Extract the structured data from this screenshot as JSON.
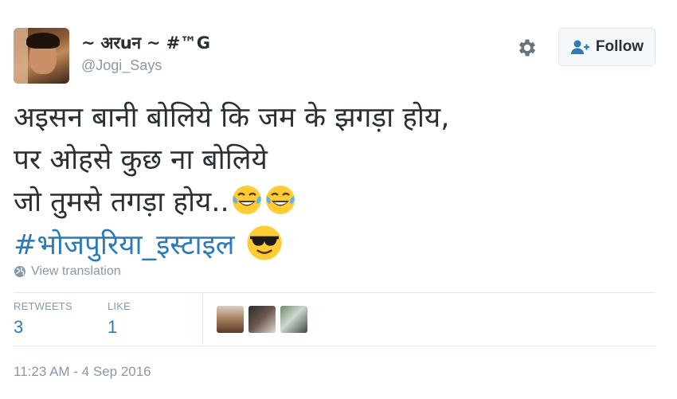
{
  "user": {
    "name": "~ अरuन ~ #™G",
    "handle": "@Jogi_Says"
  },
  "actions": {
    "follow_label": "Follow"
  },
  "tweet": {
    "line1": "अइसन बानी बोलिये कि जम के झगड़ा होय,",
    "line2": "पर ओहसे कुछ ना बोलिये",
    "line3": "जो तुमसे तगड़ा होय..",
    "hashtag": "#भोजपुरिया_इस्टाइल"
  },
  "translate_label": "View translation",
  "stats": {
    "retweets_label": "RETWEETS",
    "retweets_count": "3",
    "likes_label": "LIKE",
    "likes_count": "1"
  },
  "timestamp": "11:23 AM - 4 Sep 2016",
  "colors": {
    "link": "#2b7bb9",
    "muted": "#8899a6",
    "text": "#292f33"
  }
}
